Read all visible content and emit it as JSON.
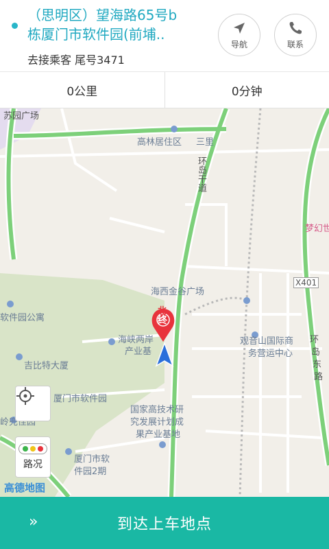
{
  "header": {
    "destination_line1": "（思明区）望海路65号b",
    "destination_line2": "栋厦门市软件园(前埔..",
    "passenger_info": "去接乘客 尾号3471",
    "navigate_label": "导航",
    "contact_label": "联系"
  },
  "stats": {
    "distance": "0公里",
    "duration": "0分钟"
  },
  "map": {
    "labels": {
      "gaolin": "高林居住区",
      "gaolin_cont": "三里",
      "huandao_road": "环岛干道",
      "menghuan": "梦幻世",
      "x401": "X401",
      "haixi": "海西金谷广场",
      "software_apartment": "软件园公寓",
      "haixia": "海峡两岸",
      "industry": "产业基",
      "jibite": "吉比特大厦",
      "guanyinshan1": "观音山国际商",
      "guanyinshan2": "务营运中心",
      "huandao_east1": "环",
      "huandao_east2": "岛",
      "huandao_east3": "东",
      "huandao_east4": "路",
      "software_park": "厦门市软件园",
      "lingdou": "岭兜佳园",
      "national1": "国家高技术研",
      "national2": "究发展计划成",
      "national3": "果产业基地",
      "park2_1": "厦门市软",
      "park2_2": "件园2期",
      "top_left": "苏园广场",
      "marker_text": "终",
      "north": "北"
    },
    "traffic_label": "路况",
    "logo": "高德地图"
  },
  "footer": {
    "action_label": "到达上车地点",
    "chevron": "»"
  },
  "colors": {
    "accent": "#21a9c1",
    "footer": "#1ab8a4",
    "road_green": "#7dd07a",
    "marker_red": "#e8333c",
    "arrow_blue": "#2a6fdb"
  }
}
